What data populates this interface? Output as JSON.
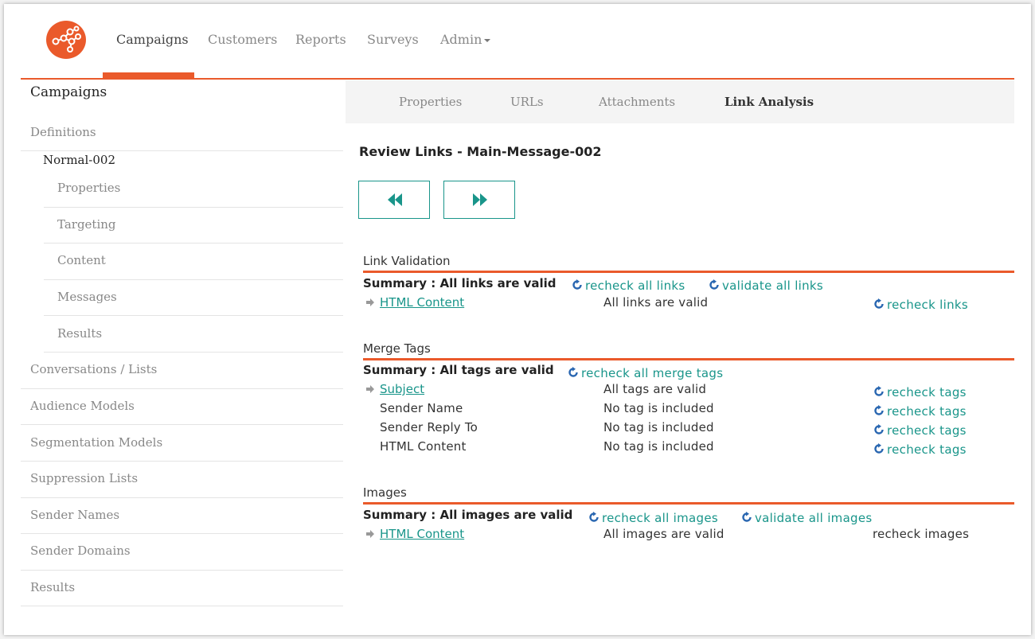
{
  "nav": {
    "items": [
      "Campaigns",
      "Customers",
      "Reports",
      "Surveys",
      "Admin"
    ]
  },
  "sidebar": {
    "title": "Campaigns",
    "definitions": "Definitions",
    "definition_name": "Normal-002",
    "sub_items": [
      "Properties",
      "Targeting",
      "Content",
      "Messages",
      "Results"
    ],
    "items": [
      "Conversations / Lists",
      "Audience Models",
      "Segmentation Models",
      "Suppression Lists",
      "Sender Names",
      "Sender Domains",
      "Results"
    ]
  },
  "tabs": [
    "Properties",
    "URLs",
    "Attachments",
    "Link Analysis"
  ],
  "page_title": "Review Links - Main-Message-002",
  "buttons": {
    "prev_icon": "rewind-icon",
    "next_icon": "fast-forward-icon"
  },
  "link_validation": {
    "title": "Link Validation",
    "summary": "Summary : All links are valid",
    "recheck_all": "recheck all links",
    "validate_all": "validate all links",
    "row": {
      "name": "HTML Content",
      "status": "All links are valid",
      "action": "recheck links"
    }
  },
  "merge_tags": {
    "title": "Merge Tags",
    "summary": "Summary : All tags are valid",
    "recheck_all": "recheck all merge tags",
    "rows": [
      {
        "name": "Subject",
        "status": "All tags are valid",
        "action": "recheck tags"
      },
      {
        "name": "Sender Name",
        "status": "No tag is included",
        "action": "recheck tags"
      },
      {
        "name": "Sender Reply To",
        "status": "No tag is included",
        "action": "recheck tags"
      },
      {
        "name": "HTML Content",
        "status": "No tag is included",
        "action": "recheck tags"
      }
    ]
  },
  "images": {
    "title": "Images",
    "summary": "Summary : All images are valid",
    "recheck_all": "recheck all images",
    "validate_all": "validate all images",
    "row": {
      "name": "HTML Content",
      "status": "All images are valid",
      "action": "recheck images"
    }
  },
  "colors": {
    "accent": "#ea5a2b",
    "link": "#19958a",
    "refresh_icon": "#2a67b1"
  }
}
